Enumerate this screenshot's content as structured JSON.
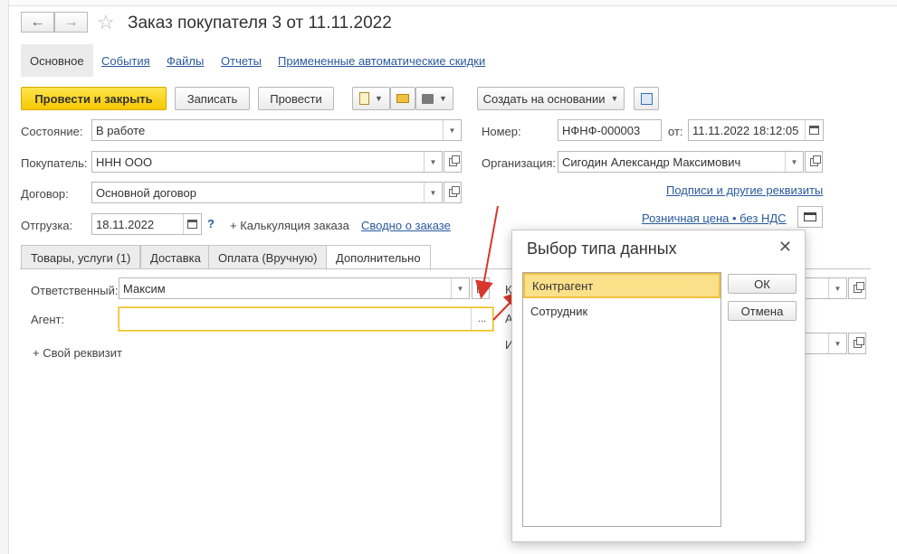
{
  "window": {
    "title": "Заказ покупателя 3 от 11.11.2022"
  },
  "section_tabs": [
    {
      "label": "Основное"
    },
    {
      "label": "События"
    },
    {
      "label": "Файлы"
    },
    {
      "label": "Отчеты"
    },
    {
      "label": "Примененные автоматические скидки"
    }
  ],
  "toolbar": {
    "post_close": "Провести и закрыть",
    "write": "Записать",
    "post": "Провести",
    "create_based": "Создать на основании"
  },
  "form": {
    "state_label": "Состояние:",
    "state_value": "В работе",
    "buyer_label": "Покупатель:",
    "buyer_value": "ННН ООО",
    "contract_label": "Договор:",
    "contract_value": "Основной договор",
    "shipment_label": "Отгрузка:",
    "shipment_value": "18.11.2022",
    "help_mark": "?",
    "calc_label": "+ Калькуляция заказа",
    "summary_link": "Сводно о заказе",
    "number_label": "Номер:",
    "number_value": "НФНФ-000003",
    "from_label": "от:",
    "date_value": "11.11.2022 18:12:05",
    "org_label": "Организация:",
    "org_value": "Сигодин Александр Максимович",
    "signatures_link": "Подписи и другие реквизиты",
    "price_link": "Розничная цена • без НДС"
  },
  "detail_tabs": [
    {
      "label": "Товары, услуги (1)"
    },
    {
      "label": "Доставка"
    },
    {
      "label": "Оплата (Вручную)"
    },
    {
      "label": "Дополнительно"
    }
  ],
  "additional": {
    "responsible_label": "Ответственный:",
    "responsible_value": "Максим",
    "agent_label": "Агент:",
    "agent_value": "",
    "agent_select": "...",
    "custom_prop": "+ Свой реквизит",
    "partial_label_1": "К",
    "partial_label_2": "А",
    "partial_label_3": "И"
  },
  "dialog": {
    "title": "Выбор типа данных",
    "items": [
      {
        "label": "Контрагент"
      },
      {
        "label": "Сотрудник"
      }
    ],
    "ok": "ОК",
    "cancel": "Отмена"
  }
}
